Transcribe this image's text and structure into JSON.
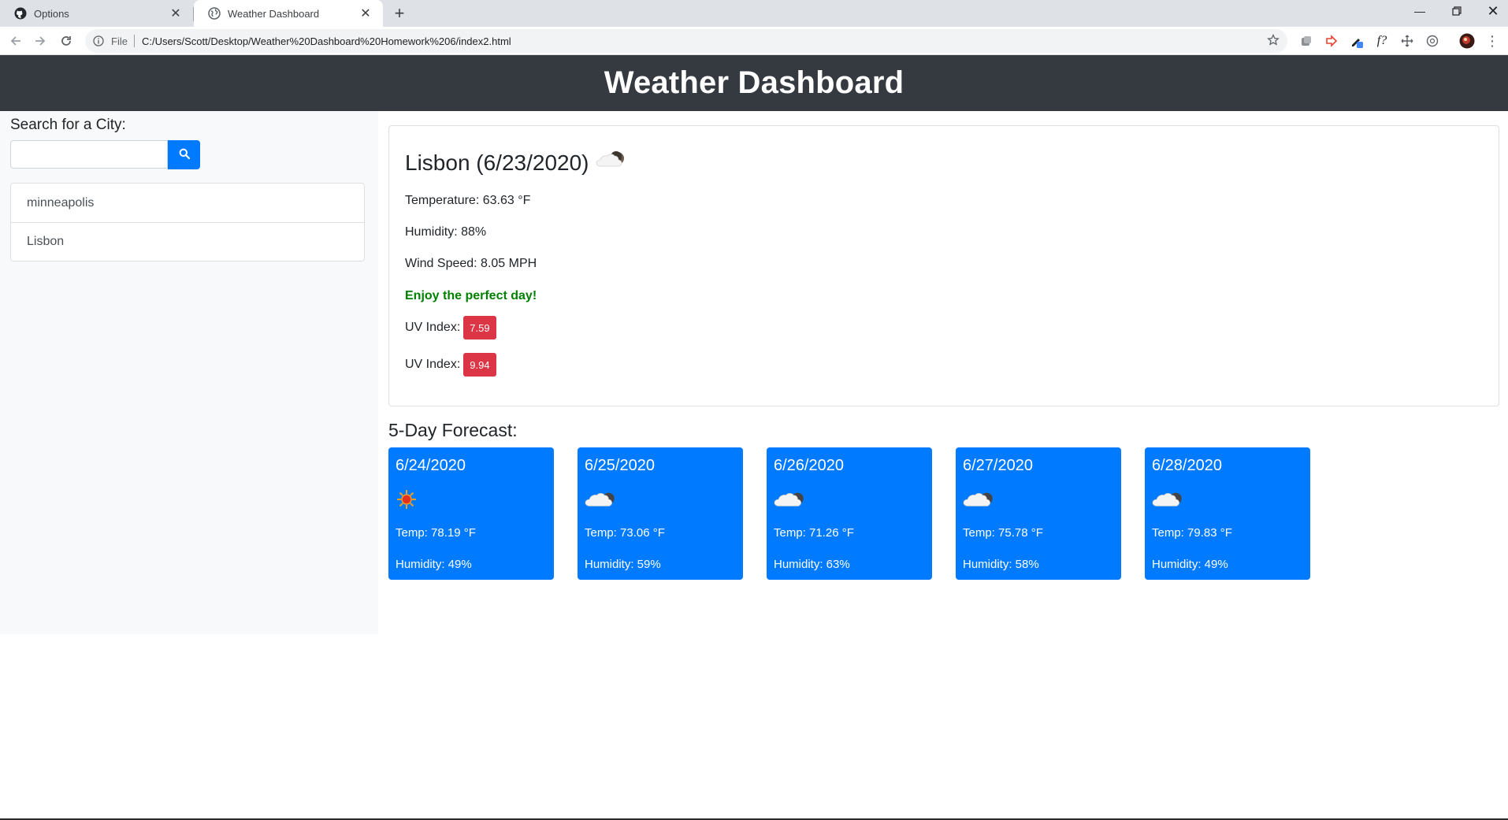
{
  "browser": {
    "tabs": [
      {
        "title": "Options",
        "icon": "github-icon"
      },
      {
        "title": "Weather Dashboard",
        "icon": "globe-icon"
      }
    ],
    "omnibox": {
      "scheme_label": "File",
      "url": "C:/Users/Scott/Desktop/Weather%20Dashboard%20Homework%206/index2.html"
    }
  },
  "header": {
    "title": "Weather Dashboard"
  },
  "sidebar": {
    "search_label": "Search for a City:",
    "search_value": "",
    "cities": [
      "minneapolis",
      "Lisbon"
    ]
  },
  "current": {
    "title": "Lisbon (6/23/2020)",
    "icon": "cloud-night-icon",
    "temperature": "Temperature: 63.63 °F",
    "humidity": "Humidity: 88%",
    "wind": "Wind Speed: 8.05 MPH",
    "message": "Enjoy the perfect day!",
    "uv_label": "UV Index:",
    "uv_values": [
      "7.59",
      "9.94"
    ]
  },
  "forecast": {
    "heading": "5-Day Forecast:",
    "days": [
      {
        "date": "6/24/2020",
        "icon": "sun-icon",
        "temp": "Temp: 78.19 °F",
        "humidity": "Humidity: 49%"
      },
      {
        "date": "6/25/2020",
        "icon": "cloud-night-icon",
        "temp": "Temp: 73.06 °F",
        "humidity": "Humidity: 59%"
      },
      {
        "date": "6/26/2020",
        "icon": "cloud-night-icon",
        "temp": "Temp: 71.26 °F",
        "humidity": "Humidity: 63%"
      },
      {
        "date": "6/27/2020",
        "icon": "cloud-night-icon",
        "temp": "Temp: 75.78 °F",
        "humidity": "Humidity: 58%"
      },
      {
        "date": "6/28/2020",
        "icon": "cloud-night-icon",
        "temp": "Temp: 79.83 °F",
        "humidity": "Humidity: 49%"
      }
    ]
  },
  "colors": {
    "header_bg": "#343a40",
    "primary": "#007bff",
    "danger": "#dc3545",
    "success_text": "#008000",
    "sidebar_bg": "#f8f9fa"
  }
}
